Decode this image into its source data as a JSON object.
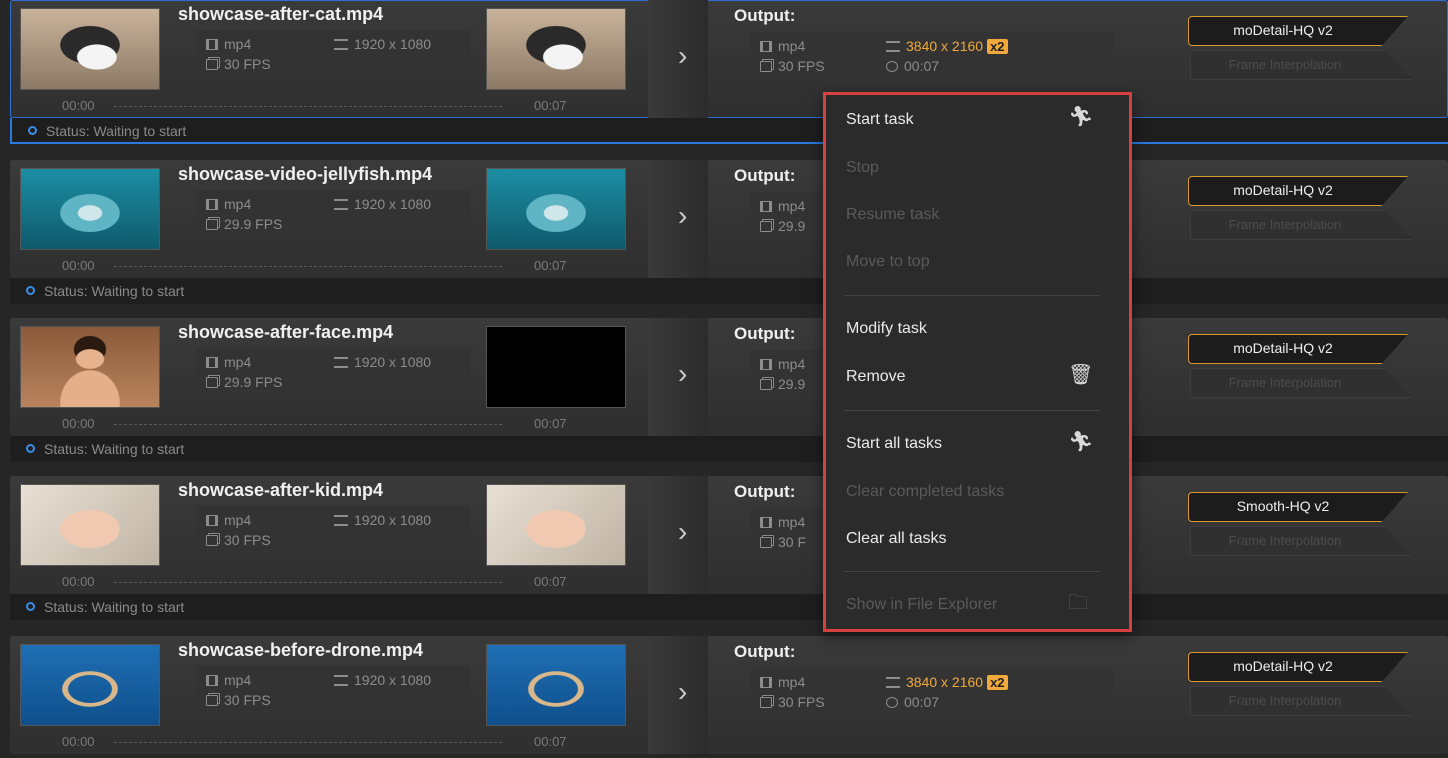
{
  "tasks": [
    {
      "filename": "showcase-after-cat.mp4",
      "input": {
        "format": "mp4",
        "resolution": "1920 x 1080",
        "fps": "30 FPS",
        "start_time": "00:00",
        "end_time": "00:07"
      },
      "output": {
        "label": "Output:",
        "format": "mp4",
        "fps": "30 FPS",
        "resolution": "3840 x 2160",
        "scale_badge": "x2",
        "duration": "00:07"
      },
      "status": "Status: Waiting to start",
      "model": "moDetail-HQ  v2",
      "frame_interpolation": "Frame Interpolation",
      "selected": true,
      "thumb": "cat"
    },
    {
      "filename": "showcase-video-jellyfish.mp4",
      "input": {
        "format": "mp4",
        "resolution": "1920 x 1080",
        "fps": "29.9 FPS",
        "start_time": "00:00",
        "end_time": "00:07"
      },
      "output": {
        "label": "Output:",
        "format": "mp4",
        "fps": "29.9"
      },
      "status": "Status: Waiting to start",
      "model": "moDetail-HQ  v2",
      "frame_interpolation": "Frame Interpolation",
      "thumb": "jelly"
    },
    {
      "filename": "showcase-after-face.mp4",
      "input": {
        "format": "mp4",
        "resolution": "1920 x 1080",
        "fps": "29.9 FPS",
        "start_time": "00:00",
        "end_time": "00:07"
      },
      "output": {
        "label": "Output:",
        "format": "mp4",
        "fps": "29.9"
      },
      "status": "Status: Waiting to start",
      "model": "moDetail-HQ  v2",
      "frame_interpolation": "Frame Interpolation",
      "thumb": "face",
      "thumb_out": "black"
    },
    {
      "filename": "showcase-after-kid.mp4",
      "input": {
        "format": "mp4",
        "resolution": "1920 x 1080",
        "fps": "30 FPS",
        "start_time": "00:00",
        "end_time": "00:07"
      },
      "output": {
        "label": "Output:",
        "format": "mp4",
        "fps": "30 F"
      },
      "status": "Status: Waiting to start",
      "model": "Smooth-HQ  v2",
      "frame_interpolation": "Frame Interpolation",
      "thumb": "kid"
    },
    {
      "filename": "showcase-before-drone.mp4",
      "input": {
        "format": "mp4",
        "resolution": "1920 x 1080",
        "fps": "30 FPS",
        "start_time": "00:00",
        "end_time": "00:07"
      },
      "output": {
        "label": "Output:",
        "format": "mp4",
        "fps": "30 FPS",
        "resolution": "3840 x 2160",
        "scale_badge": "x2",
        "duration": "00:07"
      },
      "model": "moDetail-HQ  v2",
      "frame_interpolation": "Frame Interpolation",
      "thumb": "drone"
    }
  ],
  "context_menu": {
    "items": [
      {
        "label": "Start task",
        "enabled": true,
        "icon": "running-person-icon"
      },
      {
        "label": "Stop",
        "enabled": false
      },
      {
        "label": "Resume task",
        "enabled": false
      },
      {
        "label": "Move to top",
        "enabled": false
      },
      {
        "label": "Modify task",
        "enabled": true
      },
      {
        "label": "Remove",
        "enabled": true,
        "icon": "trash-icon"
      },
      {
        "label": "Start all tasks",
        "enabled": true,
        "icon": "run-all-icon"
      },
      {
        "label": "Clear completed tasks",
        "enabled": false
      },
      {
        "label": "Clear all tasks",
        "enabled": true
      },
      {
        "label": "Show in File Explorer",
        "enabled": false,
        "icon": "folder-icon"
      }
    ]
  },
  "colors": {
    "accent": "#f2a93b",
    "selection": "#2a7ae2",
    "menu_highlight_border": "#d84040"
  }
}
